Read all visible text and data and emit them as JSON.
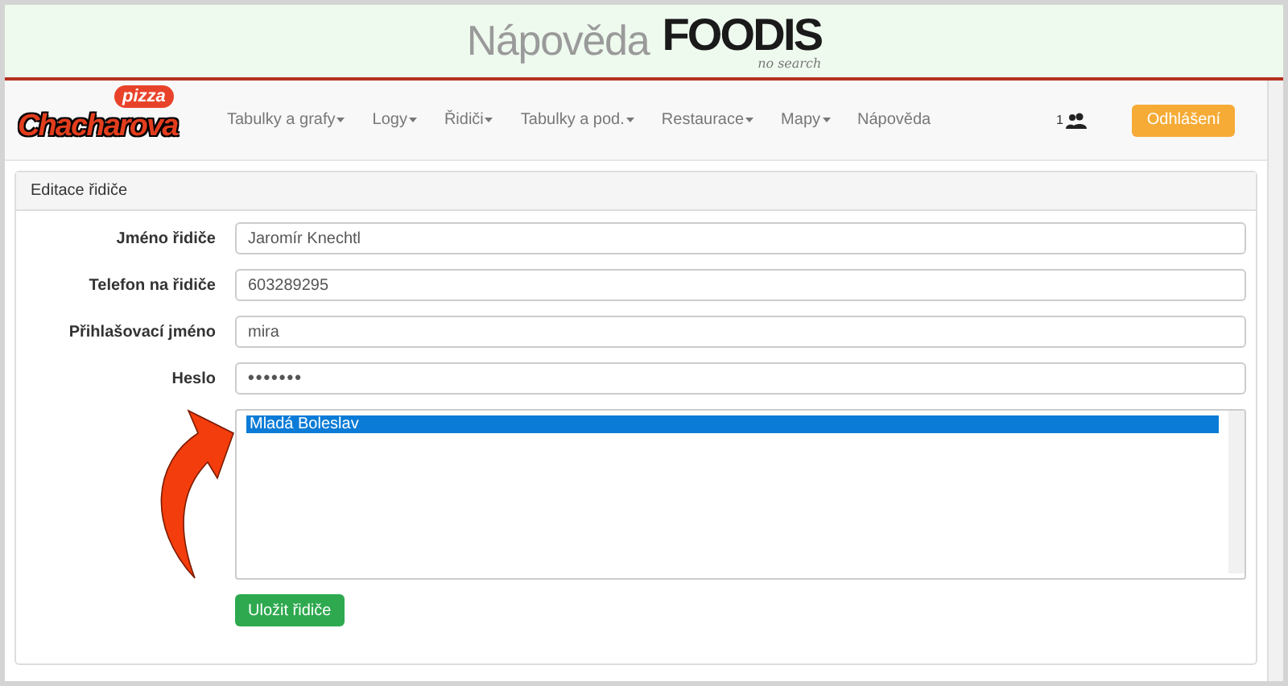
{
  "header": {
    "title": "Nápověda",
    "logo": {
      "name": "FOODIS",
      "tagline": "no search"
    }
  },
  "navbar": {
    "brand": {
      "name": "Chacharova",
      "tag": "pizza"
    },
    "menu": [
      {
        "label": "Tabulky a grafy",
        "dropdown": true
      },
      {
        "label": "Logy",
        "dropdown": true
      },
      {
        "label": "Řidiči",
        "dropdown": true
      },
      {
        "label": "Tabulky a pod.",
        "dropdown": true
      },
      {
        "label": "Restaurace",
        "dropdown": true
      },
      {
        "label": "Mapy",
        "dropdown": true
      },
      {
        "label": "Nápověda",
        "dropdown": false
      }
    ],
    "user_count": "1",
    "logout": "Odhlášení"
  },
  "panel": {
    "title": "Editace řidiče",
    "fields": [
      {
        "label": "Jméno řidiče",
        "value": "Jaromír Knechtl",
        "kind": "text"
      },
      {
        "label": "Telefon na řidiče",
        "value": "603289295",
        "kind": "text"
      },
      {
        "label": "Přihlašovací jméno",
        "value": "mira",
        "kind": "text"
      },
      {
        "label": "Heslo",
        "value": "•••••••",
        "kind": "password"
      }
    ],
    "listbox": {
      "options": [
        {
          "label": "Mladá Boleslav",
          "selected": true
        }
      ]
    },
    "submit": "Uložit řidiče"
  }
}
